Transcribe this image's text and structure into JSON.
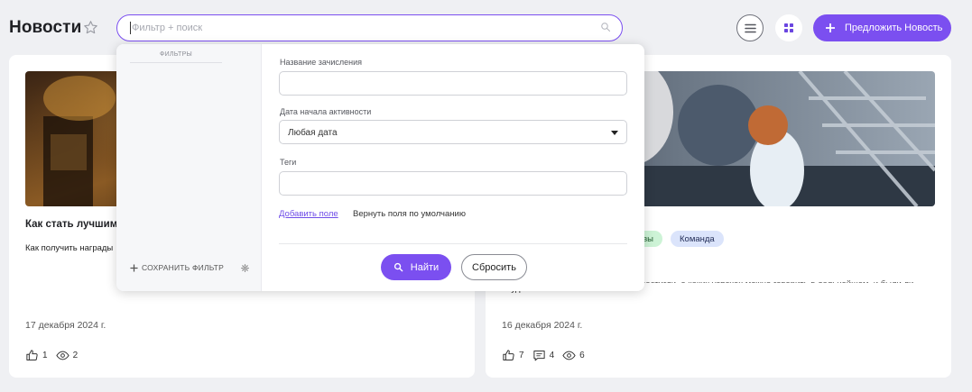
{
  "header": {
    "title": "Новости",
    "search_placeholder": "Фильтр + поиск",
    "propose_label": "Предложить Новость"
  },
  "colors": {
    "accent": "#7b4ff0",
    "background": "#eff0f3",
    "tag_green": "#cdf3d6",
    "tag_blue": "#dbe4fb"
  },
  "icons": {
    "favorite": "star-icon",
    "search": "search-icon",
    "list_view": "list-icon",
    "grid_view": "grid-icon",
    "add": "plus-icon",
    "like": "thumbs-up-icon",
    "views": "eye-icon",
    "comments": "comment-icon",
    "settings": "gear-icon",
    "select": "chevron-down-icon"
  },
  "filter_panel": {
    "sidebar_title": "ФИЛЬТРЫ",
    "save_filter_label": "СОХРАНИТЬ ФИЛЬТР",
    "fields": [
      {
        "label": "Название зачисления",
        "value": ""
      },
      {
        "label": "Дата начала активности",
        "value": "Любая дата"
      },
      {
        "label": "Теги",
        "value": ""
      }
    ],
    "add_field_label": "Добавить поле",
    "reset_defaults_label": "Вернуть поля по умолчанию",
    "find_label": "Найти",
    "reset_label": "Сбросить"
  },
  "cards": [
    {
      "title": "Как стать лучшим",
      "excerpt": "Как получить награды",
      "date": "17 декабря 2024 г.",
      "likes": "1",
      "views": "2"
    },
    {
      "tags": [
        "вы",
        "Команда"
      ],
      "excerpt_line1": "Поговорим о результатах: чего мы достигли, о каких успехах можно говорить в дальнейшем, и были ли",
      "excerpt_line2": "неудачи?...",
      "date": "16 декабря 2024 г.",
      "likes": "7",
      "comments": "4",
      "views": "6"
    }
  ]
}
